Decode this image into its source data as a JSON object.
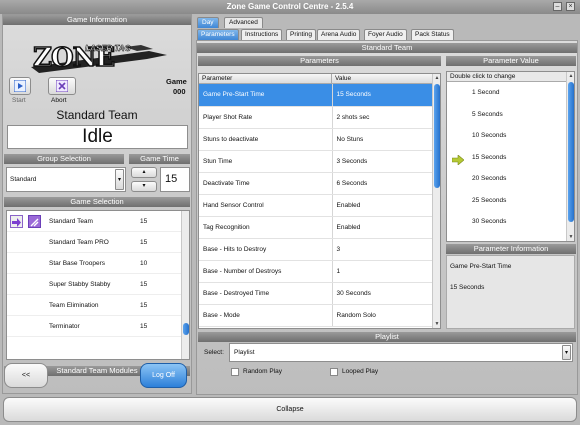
{
  "window": {
    "title": "Zone Game Control Centre - 2.5.4",
    "minimize_glyph": "–",
    "close_glyph": "×"
  },
  "left": {
    "game_info_header": "Game Information",
    "logo_text_main": "ZONE",
    "logo_text_sub": "LASER TAG",
    "start_label": "Start",
    "abort_label": "Abort",
    "game_label": "Game",
    "game_number": "000",
    "team_name": "Standard Team",
    "status": "Idle",
    "group_selection_header": "Group Selection",
    "game_time_header": "Game Time",
    "group_value": "Standard",
    "game_time_value": "15",
    "game_selection_header": "Game Selection",
    "games": [
      {
        "name": "Standard Team",
        "time": "15",
        "icons": true
      },
      {
        "name": "Standard Team PRO",
        "time": "15",
        "icons": false
      },
      {
        "name": "Star Base Troopers",
        "time": "10",
        "icons": false
      },
      {
        "name": "Super Stabby Stabby",
        "time": "15",
        "icons": false
      },
      {
        "name": "Team Elimination",
        "time": "15",
        "icons": false
      },
      {
        "name": "Terminator",
        "time": "15",
        "icons": false
      }
    ],
    "modules_header": "Standard Team Modules",
    "back_label": "<<",
    "logoff_label": "Log Off"
  },
  "tabs": [
    "Day",
    "Advanced"
  ],
  "subtabs": [
    "Parameters",
    "Instructions",
    "Printing",
    "Arena Audio",
    "Foyer Audio",
    "Pack Status"
  ],
  "content": {
    "section_title": "Standard Team",
    "parameters_header": "Parameters",
    "col_parameter": "Parameter",
    "col_value": "Value",
    "parameters": [
      {
        "name": "Game Pre-Start Time",
        "value": "15 Seconds"
      },
      {
        "name": "Player Shot Rate",
        "value": "2 shots sec"
      },
      {
        "name": "Stuns to deactivate",
        "value": "No Stuns"
      },
      {
        "name": "Stun Time",
        "value": "3 Seconds"
      },
      {
        "name": "Deactivate Time",
        "value": "6 Seconds"
      },
      {
        "name": "Hand Sensor Control",
        "value": "Enabled"
      },
      {
        "name": "Tag Recognition",
        "value": "Enabled"
      },
      {
        "name": "Base - Hits to Destroy",
        "value": "3"
      },
      {
        "name": "Base - Number of Destroys",
        "value": "1"
      },
      {
        "name": "Base - Destroyed Time",
        "value": "30 Seconds"
      },
      {
        "name": "Base - Mode",
        "value": "Random Solo"
      }
    ],
    "selected_parameter_index": 0,
    "param_value_header": "Parameter Value",
    "param_value_hint": "Double click to change",
    "param_values": [
      "1 Second",
      "5 Seconds",
      "10 Seconds",
      "15 Seconds",
      "20 Seconds",
      "25 Seconds",
      "30 Seconds"
    ],
    "current_value_index": 3,
    "param_info_header": "Parameter Information",
    "param_info_name": "Game Pre-Start Time",
    "param_info_value": "15 Seconds",
    "playlist_header": "Playlist",
    "select_label": "Select:",
    "playlist_value": "Playlist",
    "random_play_label": "Random Play",
    "looped_play_label": "Looped Play",
    "random_play_checked": false,
    "looped_play_checked": false
  },
  "footer": {
    "collapse_label": "Collapse"
  },
  "colors": {
    "accent": "#3a8ee6",
    "header": "#7d7d7d",
    "background": "#c4c4c4"
  }
}
